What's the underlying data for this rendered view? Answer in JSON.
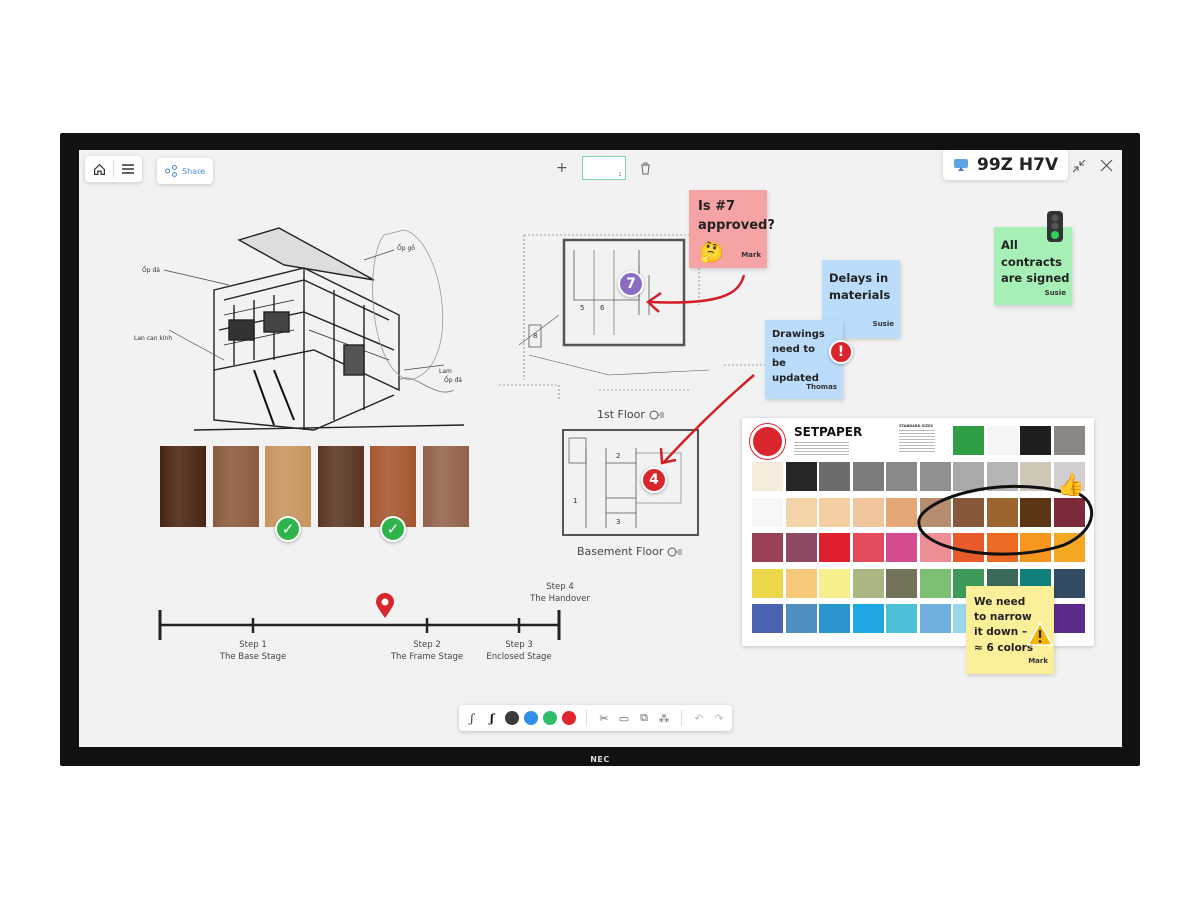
{
  "device": {
    "brand": "NEC"
  },
  "toolbar": {
    "home_icon": "home-icon",
    "menu_icon": "hamburger-menu-icon",
    "share_label": "Share",
    "share_icon": "share-icon"
  },
  "pages": {
    "add_icon": "plus-icon",
    "current_page": "1",
    "delete_icon": "trash-icon"
  },
  "room": {
    "code": "99Z H7V",
    "cast_icon": "screen-cast-icon",
    "minimize_icon": "minimize-icon",
    "close_icon": "close-icon"
  },
  "sketch": {
    "annotations": [
      "Ốp đá",
      "Ốp gỗ",
      "Lan can kính",
      "Lam",
      "Ốp đá"
    ]
  },
  "wood_swatches": [
    {
      "color": "#4a2412",
      "approved": false
    },
    {
      "color": "#8c5a3c",
      "approved": false
    },
    {
      "color": "#c9955f",
      "approved": true
    },
    {
      "color": "#5a3522",
      "approved": false
    },
    {
      "color": "#a5572f",
      "approved": true
    },
    {
      "color": "#93624a",
      "approved": false
    }
  ],
  "floorplans": {
    "first": {
      "label": "1st Floor",
      "marker": "7",
      "room_numbers": [
        "5",
        "6",
        "8"
      ]
    },
    "basement": {
      "label": "Basement Floor",
      "marker": "4",
      "room_numbers": [
        "1",
        "2",
        "3"
      ]
    }
  },
  "timeline": {
    "steps": [
      {
        "step": "Step 1",
        "name": "The Base Stage"
      },
      {
        "step": "Step 2",
        "name": "The Frame Stage"
      },
      {
        "step": "Step 3",
        "name": "Enclosed Stage"
      },
      {
        "step": "Step 4",
        "name": "The Handover"
      }
    ],
    "progress_marker": "location-pin-icon"
  },
  "stickies": [
    {
      "id": "approved",
      "text": "Is #7 approved?",
      "author": "Mark",
      "color": "#f6a3a6",
      "emoji": "thinking-face-icon"
    },
    {
      "id": "delays",
      "text": "Delays in materials",
      "author": "Susie",
      "color": "#bcdcfb"
    },
    {
      "id": "drawings",
      "text": "Drawings need to be updated",
      "author": "Thomas",
      "color": "#bcdcfb",
      "emoji": "fire-alert-icon"
    },
    {
      "id": "contracts",
      "text": "All contracts are signed",
      "author": "Susie",
      "color": "#a6f0b8",
      "emoji": "traffic-light-icon"
    },
    {
      "id": "narrow",
      "text": "We need to narrow it down – ≈ 6 colors",
      "author": "Mark",
      "color": "#fbef9a",
      "emoji": "warning-icon"
    }
  ],
  "palette": {
    "brand": "SETPAPER",
    "subtitle": "STANDARD SIZES",
    "rows": [
      [
        "#2f9e44",
        "#f5f5f5",
        "#1f1f1f",
        "#8c8784"
      ],
      [
        "#f6ecdc",
        "#262626",
        "#6a6d6a",
        "#7c7c7a",
        "#8a8888",
        "#8f9092",
        "#a9a9a9",
        "#b5b5b5",
        "#cfc7b5",
        "#d3cfd0"
      ],
      [
        "#f7f7f7",
        "#f6d4a9",
        "#f5cfa3",
        "#f2c69c",
        "#e6a777",
        "#b78d72",
        "#87583a",
        "#9c652e",
        "#5c3613",
        "#7c2a3a"
      ],
      [
        "#994256",
        "#8c4a66",
        "#e0202f",
        "#e34a5a",
        "#d44c8b",
        "#ee8f98",
        "#e85a2b",
        "#ec6a22",
        "#f6961d",
        "#f4a724"
      ],
      [
        "#ecd84a",
        "#f6c879",
        "#f7ef8e",
        "#a9b882",
        "#74725a",
        "#7dc074",
        "#3e9a58",
        "#3a6b5a",
        "#117f7c",
        "#334a63"
      ],
      [
        "#4a63b0",
        "#4f8fc2",
        "#2b95cd",
        "#1fa8e4",
        "#4cc0d6",
        "#6fb0de",
        "#9dd5ec",
        "#4a6fb8",
        "#3a5aa8",
        "#5d2b8c"
      ]
    ],
    "thumbs_up_icon": "thumbs-up-icon"
  },
  "pen_toolbar": {
    "pens": [
      "thin-pen-icon",
      "thick-pen-icon"
    ],
    "colors": [
      "#3a3a3a",
      "#2f8ee8",
      "#2dbf6a",
      "#e0262d"
    ],
    "tools": [
      "scissors-icon",
      "sticky-note-icon",
      "copy-icon",
      "shapes-icon"
    ],
    "undo_icon": "undo-icon",
    "redo_icon": "redo-icon"
  }
}
